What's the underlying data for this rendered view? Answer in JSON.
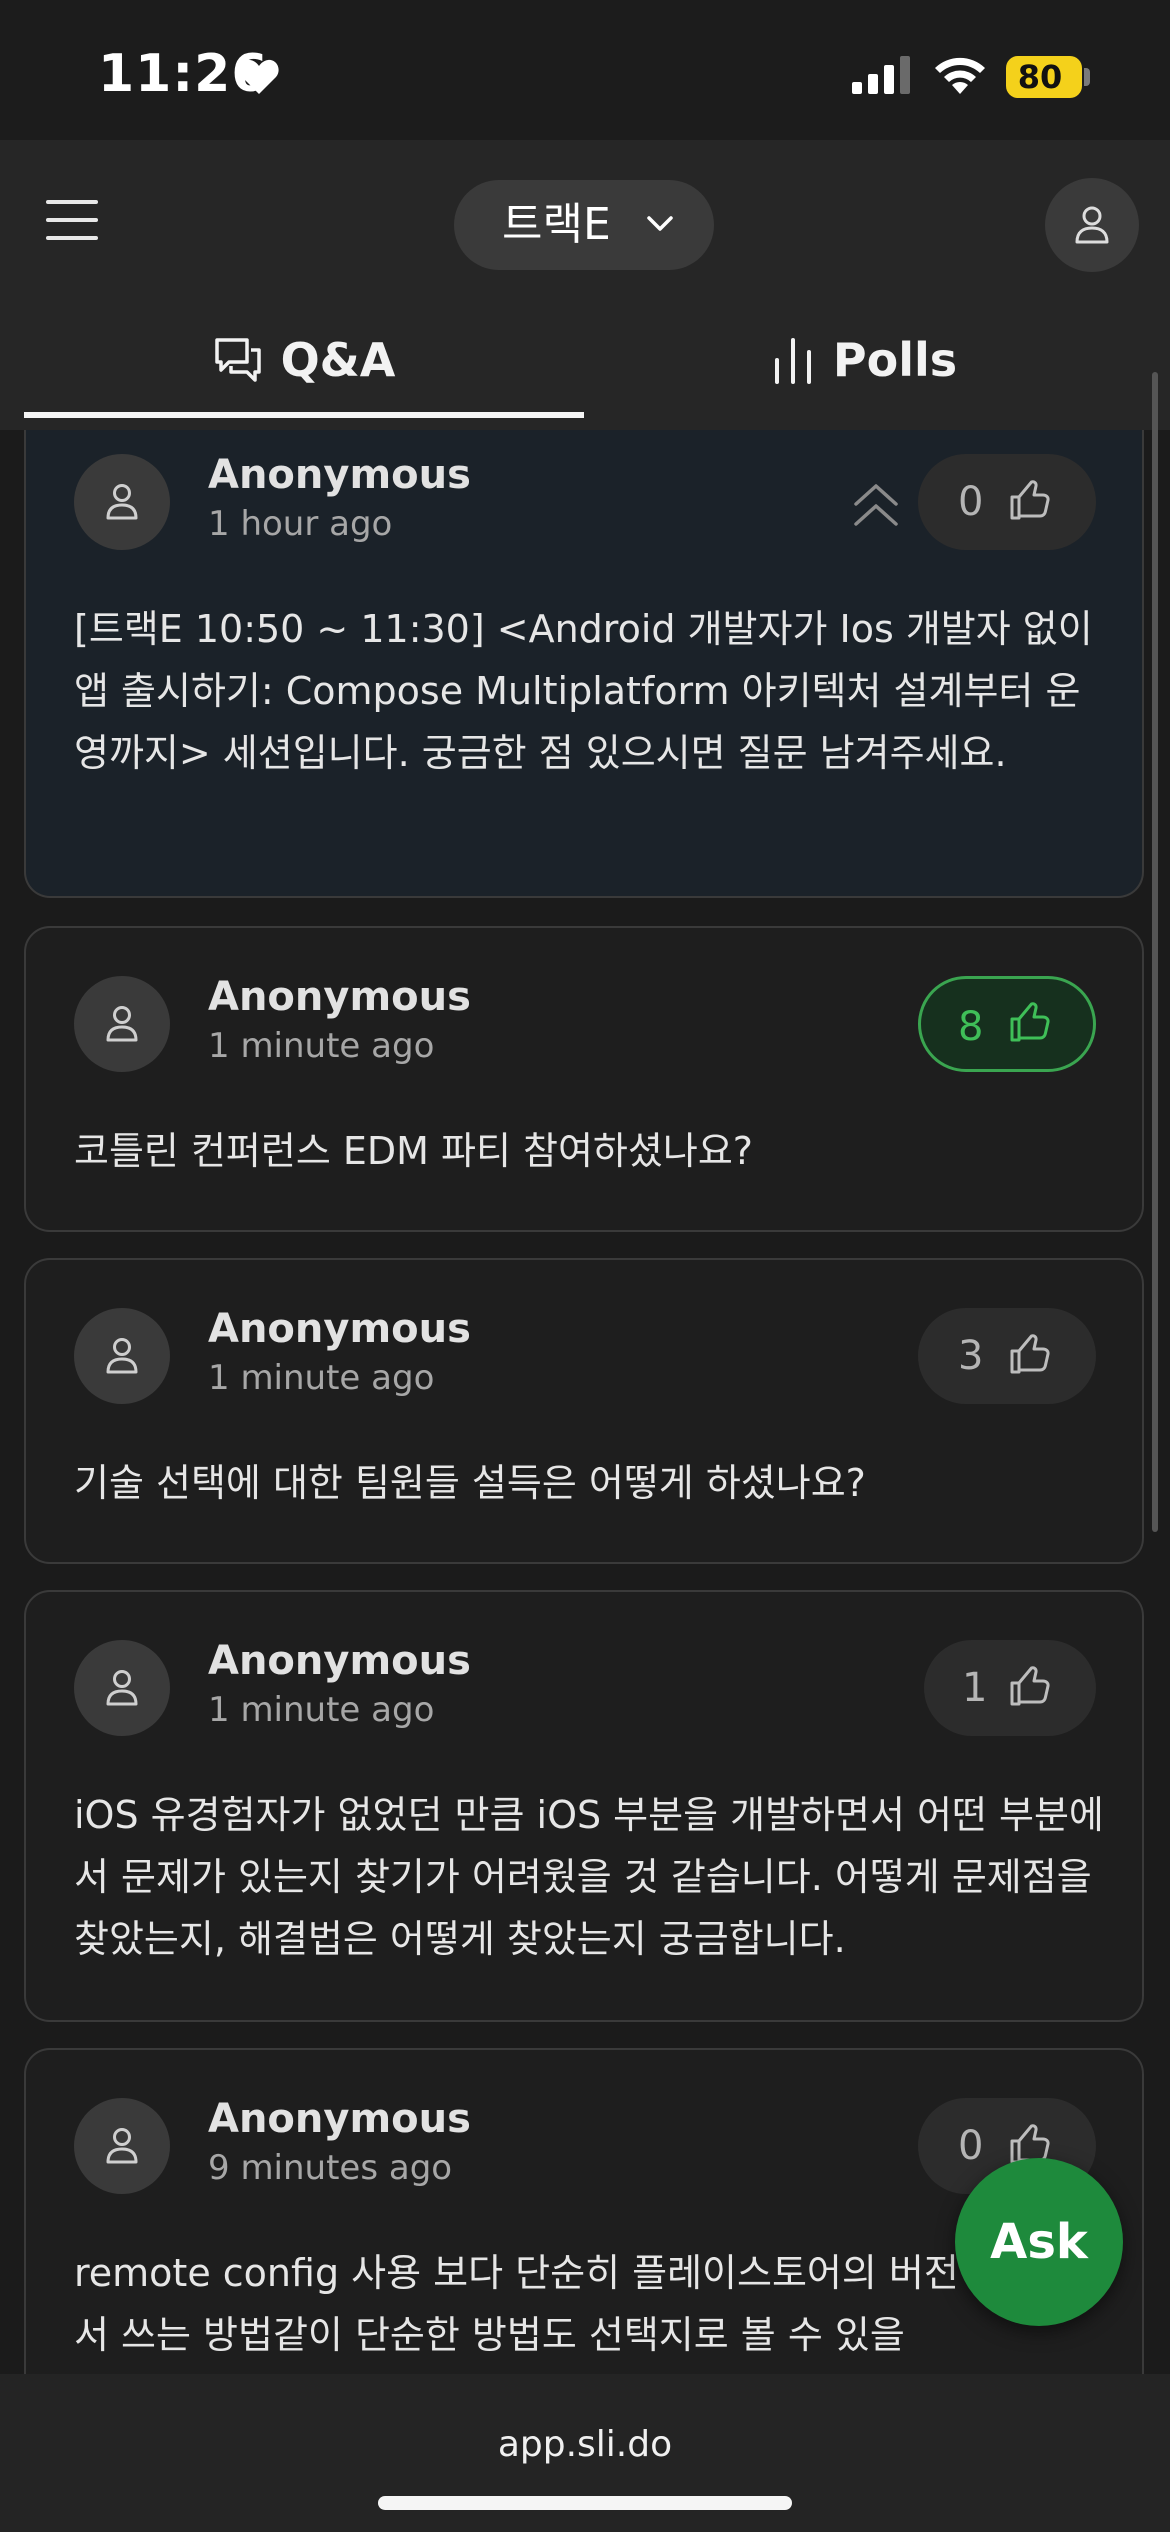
{
  "status_bar": {
    "time": "11:26",
    "battery": "80"
  },
  "header": {
    "event_name": "트랙E"
  },
  "tabs": [
    {
      "label": "Q&A",
      "icon": "chat-bubbles-icon",
      "active": true
    },
    {
      "label": "Polls",
      "icon": "bar-chart-icon",
      "active": false
    }
  ],
  "questions": [
    {
      "author": "Anonymous",
      "time": "1 hour ago",
      "likes": "0",
      "pinned": true,
      "text": "[트랙E 10:50 ~ 11:30] <Android 개발자가 Ios 개발자 없이 앱 출시하기: Compose Multiplatform 아키텍처 설계부터 운영까지> 세션입니다. 궁금한 점 있으시면 질문 남겨주세요."
    },
    {
      "author": "Anonymous",
      "time": "1 minute ago",
      "likes": "8",
      "liked": true,
      "text": "코틀린 컨퍼런스 EDM 파티 참여하셨나요?"
    },
    {
      "author": "Anonymous",
      "time": "1 minute ago",
      "likes": "3",
      "text": "기술 선택에 대한 팀원들 설득은 어떻게 하셨나요?"
    },
    {
      "author": "Anonymous",
      "time": "1 minute ago",
      "likes": "1",
      "text": "iOS 유경험자가 없었던 만큼 iOS 부분을 개발하면서 어떤 부분에서 문제가 있는지 찾기가 어려웠을 것 같습니다. 어떻게 문제점을 찾았는지, 해결법은 어떻게 찾았는지 궁금합니다."
    },
    {
      "author": "Anonymous",
      "time": "9 minutes ago",
      "likes": "0",
      "text": "remote config 사용 보다 단순히 플레이스토어의 버전 롤링 해서 쓰는 방법같이 단순한 방법도 선택지로 볼 수 있을"
    }
  ],
  "ask_button": {
    "label": "Ask"
  },
  "browser": {
    "url": "app.sli.do"
  },
  "colors": {
    "accent_green": "#1e8a3c",
    "like_active": "#3aa550",
    "pinned_bg": "#1b2229"
  }
}
